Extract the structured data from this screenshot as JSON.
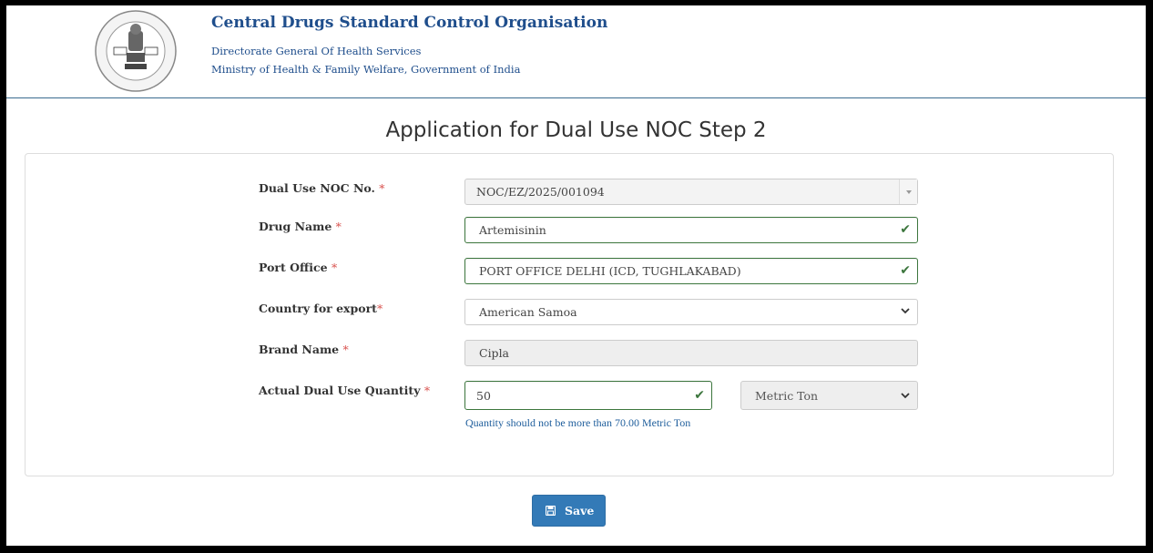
{
  "header": {
    "logo_icon": "cdsco-emblem-logo",
    "title": "Central Drugs Standard Control Organisation",
    "subtitle1": "Directorate General Of Health Services",
    "subtitle2": "Ministry of Health & Family Welfare, Government of India"
  },
  "page": {
    "title": "Application for Dual Use NOC Step 2"
  },
  "form": {
    "noc_no": {
      "label": "Dual Use NOC No. ",
      "required": "*",
      "value": "NOC/EZ/2025/001094"
    },
    "drug_name": {
      "label": "Drug Name ",
      "required": "*",
      "value": "Artemisinin"
    },
    "port_office": {
      "label": "Port Office ",
      "required": "*",
      "value": "PORT OFFICE DELHI (ICD, TUGHLAKABAD)"
    },
    "country": {
      "label": "Country for export",
      "required": "*",
      "value": "American Samoa"
    },
    "brand_name": {
      "label": "Brand Name ",
      "required": "*",
      "value": "Cipla"
    },
    "quantity": {
      "label": "Actual Dual Use Quantity ",
      "required": "*",
      "value": "50",
      "unit": "Metric Ton"
    },
    "quantity_hint": "Quantity should not be more than 70.00 Metric Ton"
  },
  "actions": {
    "save_label": "Save",
    "save_icon": "floppy-disk-icon"
  },
  "colors": {
    "primary": "#337ab7",
    "heading": "#1f4e8c",
    "valid": "#3c763d",
    "required": "#d9534f"
  }
}
